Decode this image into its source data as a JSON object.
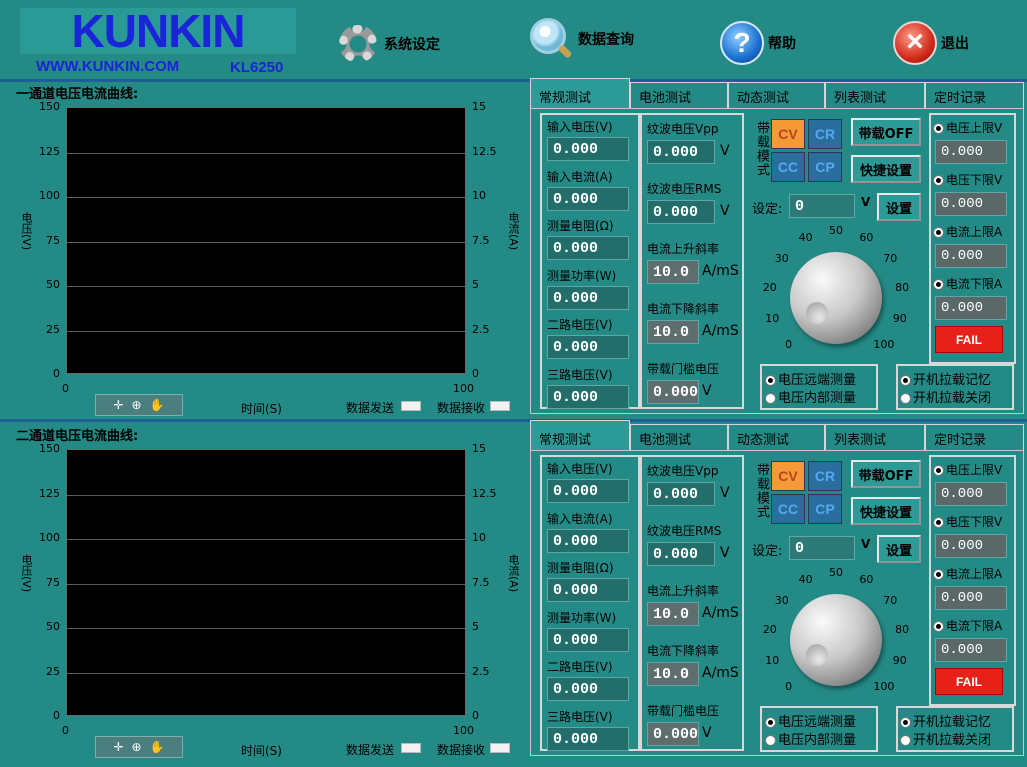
{
  "header": {
    "logo_text": "KUNKIN",
    "website": "WWW.KUNKIN.COM",
    "model": "KL6250",
    "buttons": [
      {
        "label": "系统设定",
        "icon": "gear-icon"
      },
      {
        "label": "数据查询",
        "icon": "search-icon"
      },
      {
        "label": "帮助",
        "icon": "help-icon"
      },
      {
        "label": "退出",
        "icon": "exit-icon"
      }
    ]
  },
  "colors": {
    "background": "#248a86",
    "divider": "#1d5e94",
    "plot_bg": "#000000",
    "mode_on": "#f49a37",
    "mode_off": "#2a6e9e",
    "fail": "#e8201a",
    "accent_text": "#1a24d8"
  },
  "channels": [
    {
      "title": "一通道电压电流曲线:",
      "y_left_label": "电压(V)",
      "y_right_label": "电流(A)",
      "y_left_ticks": [
        "150",
        "125",
        "100",
        "75",
        "50",
        "25",
        "0"
      ],
      "y_right_ticks": [
        "15",
        "12.5",
        "10",
        "7.5",
        "5",
        "2.5",
        "0"
      ],
      "x_ticks": [
        "0",
        "100"
      ],
      "x_label": "时间(S)",
      "send_label": "数据发送",
      "recv_label": "数据接收",
      "tabs": [
        "常规测试",
        "电池测试",
        "动态测试",
        "列表测试",
        "定时记录"
      ],
      "active_tab": 0,
      "measure": [
        {
          "label": "输入电压(V)",
          "value": "0.000"
        },
        {
          "label": "输入电流(A)",
          "value": "0.000"
        },
        {
          "label": "测量电阻(Ω)",
          "value": "0.000"
        },
        {
          "label": "测量功率(W)",
          "value": "0.000"
        },
        {
          "label": "二路电压(V)",
          "value": "0.000"
        },
        {
          "label": "三路电压(V)",
          "value": "0.000"
        }
      ],
      "ripple": [
        {
          "label": "纹波电压Vpp",
          "value": "0.000",
          "unit": "V"
        },
        {
          "label": "纹波电压RMS",
          "value": "0.000",
          "unit": "V"
        },
        {
          "label": "电流上升斜率",
          "value": "10.0",
          "unit": "A/mS"
        },
        {
          "label": "电流下降斜率",
          "value": "10.0",
          "unit": "A/mS"
        },
        {
          "label": "带载门槛电压",
          "value": "0.000",
          "unit": "V"
        }
      ],
      "mode_label": "带载模式",
      "modes": [
        "CV",
        "CR",
        "CC",
        "CP"
      ],
      "active_mode": "CV",
      "load_off_label": "带载OFF",
      "quick_set_label": "快捷设置",
      "set_label": "设定:",
      "set_value": "0",
      "set_unit": "V",
      "set_button": "设置",
      "dial_ticks": [
        "0",
        "10",
        "20",
        "30",
        "40",
        "50",
        "60",
        "70",
        "80",
        "90",
        "100"
      ],
      "limits": [
        {
          "label": "电压上限V",
          "value": "0.000",
          "checked": true
        },
        {
          "label": "电压下限V",
          "value": "0.000",
          "checked": true
        },
        {
          "label": "电流上限A",
          "value": "0.000",
          "checked": true
        },
        {
          "label": "电流下限A",
          "value": "0.000",
          "checked": true
        }
      ],
      "fail_label": "FAIL",
      "sense_options": [
        "电压远端测量",
        "电压内部测量"
      ],
      "sense_selected": 0,
      "power_options": [
        "开机拉载记忆",
        "开机拉载关闭"
      ],
      "power_selected": 0
    },
    {
      "title": "二通道电压电流曲线:",
      "y_left_label": "电压(V)",
      "y_right_label": "电流(A)",
      "y_left_ticks": [
        "150",
        "125",
        "100",
        "75",
        "50",
        "25",
        "0"
      ],
      "y_right_ticks": [
        "15",
        "12.5",
        "10",
        "7.5",
        "5",
        "2.5",
        "0"
      ],
      "x_ticks": [
        "0",
        "100"
      ],
      "x_label": "时间(S)",
      "send_label": "数据发送",
      "recv_label": "数据接收",
      "tabs": [
        "常规测试",
        "电池测试",
        "动态测试",
        "列表测试",
        "定时记录"
      ],
      "active_tab": 0,
      "measure": [
        {
          "label": "输入电压(V)",
          "value": "0.000"
        },
        {
          "label": "输入电流(A)",
          "value": "0.000"
        },
        {
          "label": "测量电阻(Ω)",
          "value": "0.000"
        },
        {
          "label": "测量功率(W)",
          "value": "0.000"
        },
        {
          "label": "二路电压(V)",
          "value": "0.000"
        },
        {
          "label": "三路电压(V)",
          "value": "0.000"
        }
      ],
      "ripple": [
        {
          "label": "纹波电压Vpp",
          "value": "0.000",
          "unit": "V"
        },
        {
          "label": "纹波电压RMS",
          "value": "0.000",
          "unit": "V"
        },
        {
          "label": "电流上升斜率",
          "value": "10.0",
          "unit": "A/mS"
        },
        {
          "label": "电流下降斜率",
          "value": "10.0",
          "unit": "A/mS"
        },
        {
          "label": "带载门槛电压",
          "value": "0.000",
          "unit": "V"
        }
      ],
      "mode_label": "带载模式",
      "modes": [
        "CV",
        "CR",
        "CC",
        "CP"
      ],
      "active_mode": "CV",
      "load_off_label": "带载OFF",
      "quick_set_label": "快捷设置",
      "set_label": "设定:",
      "set_value": "0",
      "set_unit": "V",
      "set_button": "设置",
      "dial_ticks": [
        "0",
        "10",
        "20",
        "30",
        "40",
        "50",
        "60",
        "70",
        "80",
        "90",
        "100"
      ],
      "limits": [
        {
          "label": "电压上限V",
          "value": "0.000",
          "checked": true
        },
        {
          "label": "电压下限V",
          "value": "0.000",
          "checked": true
        },
        {
          "label": "电流上限A",
          "value": "0.000",
          "checked": true
        },
        {
          "label": "电流下限A",
          "value": "0.000",
          "checked": true
        }
      ],
      "fail_label": "FAIL",
      "sense_options": [
        "电压远端测量",
        "电压内部测量"
      ],
      "sense_selected": 0,
      "power_options": [
        "开机拉载记忆",
        "开机拉载关闭"
      ],
      "power_selected": 0
    }
  ]
}
